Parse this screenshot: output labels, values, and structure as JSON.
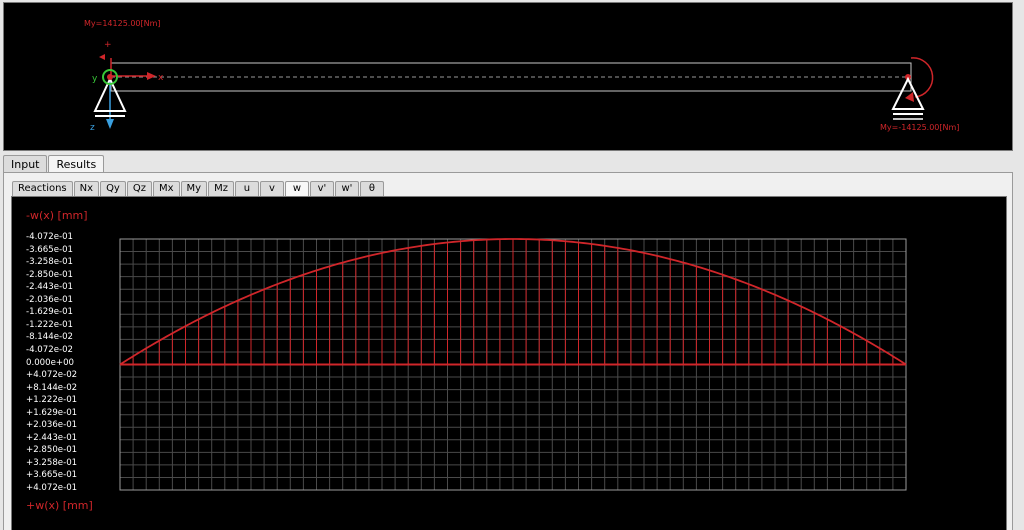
{
  "beam_view": {
    "moment_left": "My=14125.00[Nm]",
    "moment_right": "My=-14125.00[Nm]",
    "axis_x": "x",
    "axis_y": "y",
    "axis_z": "z",
    "plus_sign": "+"
  },
  "outer_tabs": [
    {
      "label": "Input",
      "active": false
    },
    {
      "label": "Results",
      "active": true
    }
  ],
  "result_tabs": [
    {
      "label": "Reactions",
      "active": false
    },
    {
      "label": "Nx",
      "active": false
    },
    {
      "label": "Qy",
      "active": false
    },
    {
      "label": "Qz",
      "active": false
    },
    {
      "label": "Mx",
      "active": false
    },
    {
      "label": "My",
      "active": false
    },
    {
      "label": "Mz",
      "active": false
    },
    {
      "label": "u",
      "active": false
    },
    {
      "label": "v",
      "active": false
    },
    {
      "label": "w",
      "active": true
    },
    {
      "label": "v'",
      "active": false
    },
    {
      "label": "w'",
      "active": false
    },
    {
      "label": "θ",
      "active": false
    }
  ],
  "colors": {
    "curve": "#d0262a",
    "grid": "#4a4a4a",
    "beam_line": "#c8c8c8"
  },
  "chart_data": {
    "type": "line",
    "ylabel_top": "-w(x)  [mm]",
    "ylabel_bottom": "+w(x)  [mm]",
    "y_ticks": [
      "-4.072e-01",
      "-3.665e-01",
      "-3.258e-01",
      "-2.850e-01",
      "-2.443e-01",
      "-2.036e-01",
      "-1.629e-01",
      "-1.222e-01",
      "-8.144e-02",
      "-4.072e-02",
      "0.000e+00",
      "+4.072e-02",
      "+8.144e-02",
      "+1.222e-01",
      "+1.629e-01",
      "+2.036e-01",
      "+2.443e-01",
      "+2.850e-01",
      "+3.258e-01",
      "+3.665e-01",
      "+4.072e-01"
    ],
    "ylim": [
      -0.4072,
      0.4072
    ],
    "xlim": [
      0,
      1
    ],
    "grid": true,
    "series": [
      {
        "x": [
          0,
          0.05,
          0.1,
          0.15,
          0.2,
          0.25,
          0.3,
          0.35,
          0.4,
          0.45,
          0.5,
          0.55,
          0.6,
          0.65,
          0.7,
          0.75,
          0.8,
          0.85,
          0.9,
          0.95,
          1
        ],
        "values": [
          0,
          -0.0774,
          -0.1466,
          -0.2077,
          -0.2606,
          -0.3054,
          -0.342,
          -0.3705,
          -0.3909,
          -0.4031,
          -0.4072,
          -0.4031,
          -0.3909,
          -0.3705,
          -0.342,
          -0.3054,
          -0.2606,
          -0.2077,
          -0.1466,
          -0.0774,
          0
        ]
      }
    ]
  }
}
